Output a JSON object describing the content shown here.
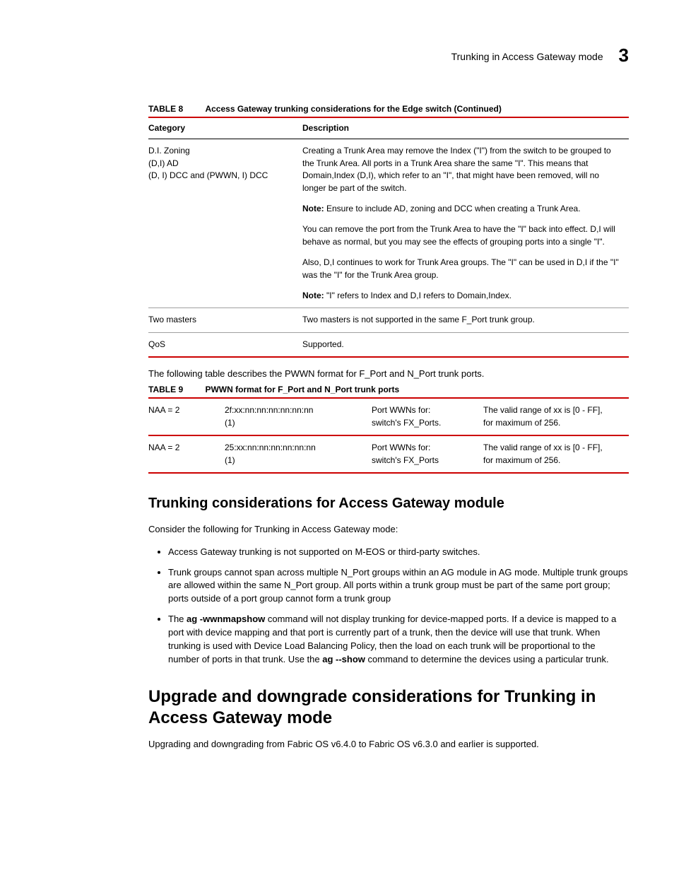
{
  "header": {
    "title": "Trunking in Access Gateway mode",
    "chapter": "3"
  },
  "table8": {
    "label": "TABLE 8",
    "title": "Access Gateway trunking considerations for the Edge switch (Continued)",
    "col1": "Category",
    "col2": "Description",
    "rows": [
      {
        "cat1": "D.I. Zoning",
        "cat2": "(D,I) AD",
        "cat3": "(D, I) DCC and (PWWN, I) DCC",
        "p1": "Creating a Trunk Area may remove the Index (\"I\") from the switch to be grouped to the Trunk Area. All ports in a Trunk Area share the same \"I\". This means that Domain,Index (D,I), which refer to an \"I\", that might have been removed, will no longer be part of the switch.",
        "note1_lead": "Note:",
        "note1_text": " Ensure to include AD, zoning and DCC when creating a Trunk Area.",
        "p2": "You can remove the port from the Trunk Area to have the \"I\" back into effect. D,I will behave as normal, but you may see the effects of grouping ports into a single \"I\".",
        "p3": "Also, D,I continues to work for Trunk Area groups. The \"I\" can be used in D,I if the \"I\" was the \"I\" for the Trunk Area group.",
        "note2_lead": "Note:",
        "note2_text": " \"I\" refers to Index and D,I refers to Domain,Index."
      },
      {
        "cat": "Two masters",
        "desc": "Two masters is not supported in the same F_Port trunk group."
      },
      {
        "cat": "QoS",
        "desc": "Supported."
      }
    ]
  },
  "lead9": "The following table describes the PWWN format for F_Port and N_Port trunk ports.",
  "table9": {
    "label": "TABLE 9",
    "title": "PWWN format for F_Port and N_Port trunk ports",
    "rows": [
      {
        "c1": "NAA = 2",
        "c2a": "2f:xx:nn:nn:nn:nn:nn:nn",
        "c2b": "(1)",
        "c3a": "Port WWNs for:",
        "c3b": "switch's FX_Ports.",
        "c4a": "The valid range of xx is [0 - FF],",
        "c4b": "for maximum of 256."
      },
      {
        "c1": "NAA = 2",
        "c2a": "25:xx:nn:nn:nn:nn:nn:nn",
        "c2b": "(1)",
        "c3a": "Port WWNs for:",
        "c3b": "switch's FX_Ports",
        "c4a": "The valid range of xx is [0 - FF],",
        "c4b": "for maximum of 256."
      }
    ]
  },
  "section1": {
    "heading": "Trunking considerations for Access Gateway module",
    "intro": "Consider the following for Trunking in Access Gateway mode:",
    "b1": "Access Gateway trunking is not supported on M-EOS or third-party switches.",
    "b2": "Trunk groups cannot span across multiple N_Port groups within an AG module in AG mode. Multiple trunk groups are allowed within the same N_Port group. All ports within a trunk group must be part of the same port group; ports outside of a port group cannot form a trunk group",
    "b3a": "The ",
    "b3_cmd1": "ag -wwnmapshow",
    "b3b": " command will not display trunking for device-mapped ports. If a device is mapped to a port with device mapping and that port is currently part of a trunk, then the device will use that trunk. When trunking is used with Device Load Balancing Policy, then the load on each trunk will be proportional to the number of ports in that trunk. Use the ",
    "b3_cmd2": "ag --show",
    "b3c": " command to determine the devices using a particular trunk."
  },
  "section2": {
    "heading": "Upgrade and downgrade considerations for Trunking in Access Gateway mode",
    "p1": "Upgrading and downgrading from Fabric OS v6.4.0 to Fabric OS v6.3.0 and earlier is supported."
  }
}
